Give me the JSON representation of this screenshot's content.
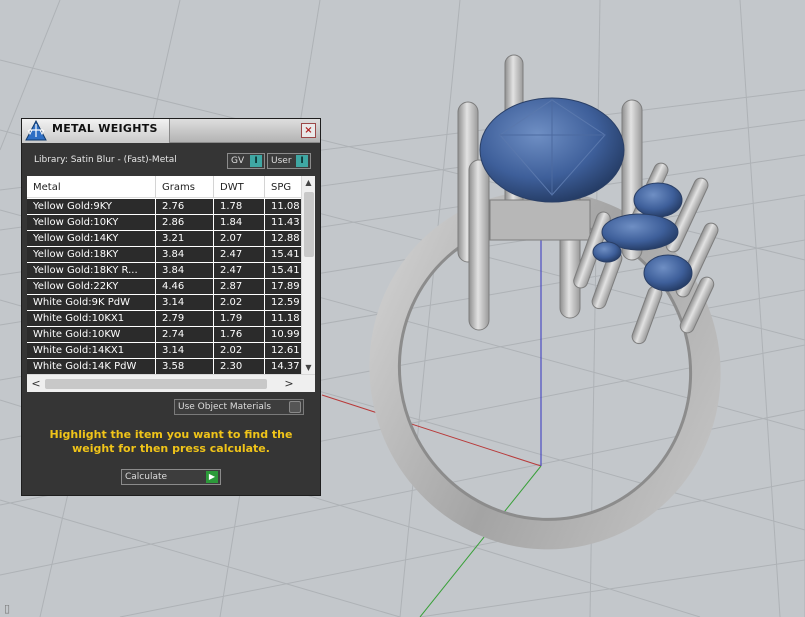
{
  "panel": {
    "title": "METAL WEIGHTS",
    "close_glyph": "×",
    "library_label": "Library: Satin Blur - (Fast)-Metal",
    "toggles": [
      {
        "label": "GV",
        "knob": "I"
      },
      {
        "label": "User",
        "knob": "I"
      }
    ],
    "table": {
      "columns": [
        "Metal",
        "Grams",
        "DWT",
        "SPG"
      ],
      "rows": [
        [
          "Yellow Gold:9KY",
          "2.76",
          "1.78",
          "11.08"
        ],
        [
          "Yellow Gold:10KY",
          "2.86",
          "1.84",
          "11.43"
        ],
        [
          "Yellow Gold:14KY",
          "3.21",
          "2.07",
          "12.88"
        ],
        [
          "Yellow Gold:18KY",
          "3.84",
          "2.47",
          "15.41"
        ],
        [
          "Yellow Gold:18KY R...",
          "3.84",
          "2.47",
          "15.41"
        ],
        [
          "Yellow Gold:22KY",
          "4.46",
          "2.87",
          "17.89"
        ],
        [
          "White Gold:9K PdW",
          "3.14",
          "2.02",
          "12.59"
        ],
        [
          "White Gold:10KX1",
          "2.79",
          "1.79",
          "11.18"
        ],
        [
          "White Gold:10KW",
          "2.74",
          "1.76",
          "10.99"
        ],
        [
          "White Gold:14KX1",
          "3.14",
          "2.02",
          "12.61"
        ],
        [
          "White Gold:14K PdW",
          "3.58",
          "2.30",
          "14.37"
        ]
      ],
      "scroll_up": "▲",
      "scroll_down": "▼",
      "scroll_left": "<",
      "scroll_right": ">"
    },
    "use_object_materials": "Use Object Materials",
    "instruction": "Highlight the item you want to find the weight for then press calculate.",
    "calculate_label": "Calculate",
    "calculate_glyph": "▶"
  },
  "colors": {
    "panel_bg": "#353535",
    "row_bg": "#2b2b2b",
    "instruction": "#f0c419",
    "toggle_knob": "#3fa7a3",
    "go_button": "#2c9a3a",
    "gem_blue": "#3e5f9a",
    "metal_gray": "#a8a8a8"
  },
  "viewport": {
    "content": "3D ring model with oval blue center stone and side stones on perspective grid",
    "icons": [
      "axis-x-red",
      "axis-y-green",
      "axis-z-blue"
    ]
  }
}
